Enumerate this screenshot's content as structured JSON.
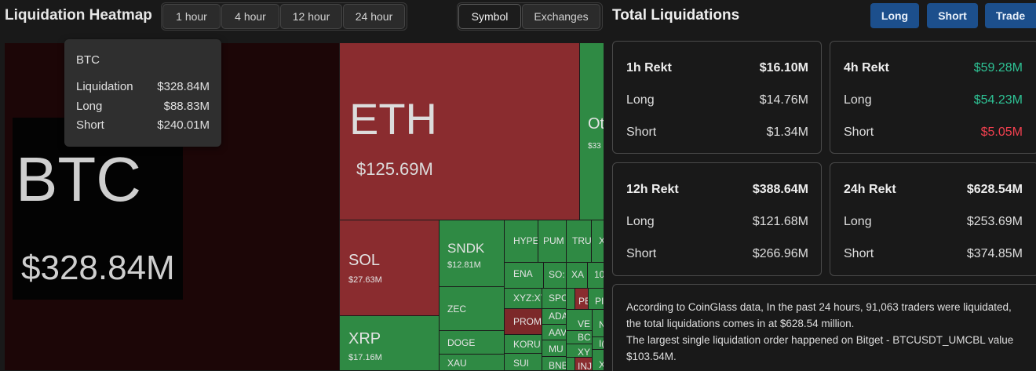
{
  "heatmap": {
    "title": "Liquidation Heatmap",
    "timeframes": [
      "1 hour",
      "4 hour",
      "12 hour",
      "24 hour"
    ],
    "views": [
      "Symbol",
      "Exchanges"
    ],
    "active_view": "Symbol",
    "tiles": {
      "btc": {
        "symbol": "BTC",
        "value": "$328.84M"
      },
      "eth": {
        "symbol": "ETH",
        "value": "$125.69M"
      },
      "other": {
        "symbol": "Ot",
        "value": "$33"
      },
      "sol": {
        "symbol": "SOL",
        "value": "$27.63M"
      },
      "xrp": {
        "symbol": "XRP",
        "value": "$17.16M"
      },
      "sndk": {
        "symbol": "SNDK",
        "value": "$12.81M"
      },
      "zec": {
        "symbol": "ZEC"
      },
      "doge": {
        "symbol": "DOGE"
      },
      "xau": {
        "symbol": "XAU"
      },
      "hype": {
        "symbol": "HYPE"
      },
      "pum": {
        "symbol": "PUM"
      },
      "tru": {
        "symbol": "TRU"
      },
      "x1": {
        "symbol": "X"
      },
      "ena": {
        "symbol": "ENA"
      },
      "so": {
        "symbol": "SO:"
      },
      "xa": {
        "symbol": "XA"
      },
      "n10": {
        "symbol": "10"
      },
      "xyz": {
        "symbol": "XYZ:XY"
      },
      "spcx": {
        "symbol": "SPCX"
      },
      "pe": {
        "symbol": "PE"
      },
      "pi": {
        "symbol": "PI"
      },
      "prom": {
        "symbol": "PROM"
      },
      "ada": {
        "symbol": "ADA"
      },
      "aave": {
        "symbol": "AAVE"
      },
      "ve": {
        "symbol": "VE"
      },
      "bc": {
        "symbol": "BC"
      },
      "n": {
        "symbol": "N"
      },
      "koru": {
        "symbol": "KORU"
      },
      "mu": {
        "symbol": "MU"
      },
      "xy": {
        "symbol": "XY"
      },
      "i": {
        "symbol": "I("
      },
      "sui": {
        "symbol": "SUI"
      },
      "bnb": {
        "symbol": "BNB"
      },
      "inj": {
        "symbol": "INJ"
      },
      "x2": {
        "symbol": "X"
      }
    },
    "tooltip": {
      "symbol": "BTC",
      "rows": [
        {
          "label": "Liquidation",
          "value": "$328.84M"
        },
        {
          "label": "Long",
          "value": "$88.83M"
        },
        {
          "label": "Short",
          "value": "$240.01M"
        }
      ]
    }
  },
  "total": {
    "title": "Total Liquidations",
    "buttons": {
      "long": "Long",
      "short": "Short",
      "trade": "Trade"
    },
    "cards": [
      {
        "title": "1h Rekt",
        "total": "$16.10M",
        "long_label": "Long",
        "long": "$14.76M",
        "short_label": "Short",
        "short": "$1.34M"
      },
      {
        "title": "4h Rekt",
        "total": "$59.28M",
        "long_label": "Long",
        "long": "$54.23M",
        "short_label": "Short",
        "short": "$5.05M"
      },
      {
        "title": "12h Rekt",
        "total": "$388.64M",
        "long_label": "Long",
        "long": "$121.68M",
        "short_label": "Short",
        "short": "$266.96M"
      },
      {
        "title": "24h Rekt",
        "total": "$628.54M",
        "long_label": "Long",
        "long": "$253.69M",
        "short_label": "Short",
        "short": "$374.85M"
      }
    ],
    "note_lines": [
      "According to CoinGlass data, In the past 24 hours, 91,063 traders were liquidated,",
      "the total liquidations comes in at $628.54 million.",
      "The largest single liquidation order happened on Bitget - BTCUSDT_UMCBL value",
      "$103.54M."
    ],
    "colors": {
      "positive": "#2ec395",
      "negative": "#f2404f",
      "button": "#1c4f8c"
    }
  }
}
